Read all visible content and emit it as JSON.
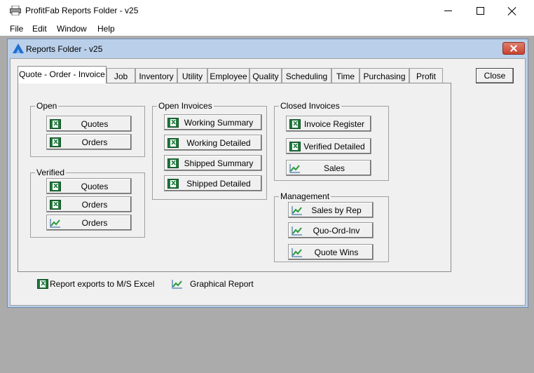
{
  "app": {
    "title": "ProfitFab Reports Folder - v25",
    "menu": [
      "File",
      "Edit",
      "Window",
      "Help"
    ]
  },
  "child": {
    "title": "Reports Folder - v25",
    "close_label": "Close"
  },
  "tabs": [
    "Quote - Order - Invoice",
    "Job",
    "Inventory",
    "Utility",
    "Employee",
    "Quality",
    "Scheduling",
    "Time",
    "Purchasing",
    "Profit"
  ],
  "groups": {
    "open": {
      "label": "Open",
      "buttons": [
        "Quotes",
        "Orders"
      ]
    },
    "verified": {
      "label": "Verified",
      "buttons": [
        "Quotes",
        "Orders",
        "Orders"
      ]
    },
    "open_invoices": {
      "label": "Open Invoices",
      "buttons": [
        "Working Summary",
        "Working Detailed",
        "Shipped  Summary",
        "Shipped Detailed"
      ]
    },
    "closed_invoices": {
      "label": "Closed Invoices",
      "buttons": [
        "Invoice Register",
        "Verified Detailed",
        "Sales"
      ]
    },
    "management": {
      "label": "Management",
      "buttons": [
        "Sales by Rep",
        "Quo-Ord-Inv",
        "Quote Wins"
      ]
    }
  },
  "legend": {
    "excel": "Report exports to M/S Excel",
    "graph": "Graphical Report"
  }
}
